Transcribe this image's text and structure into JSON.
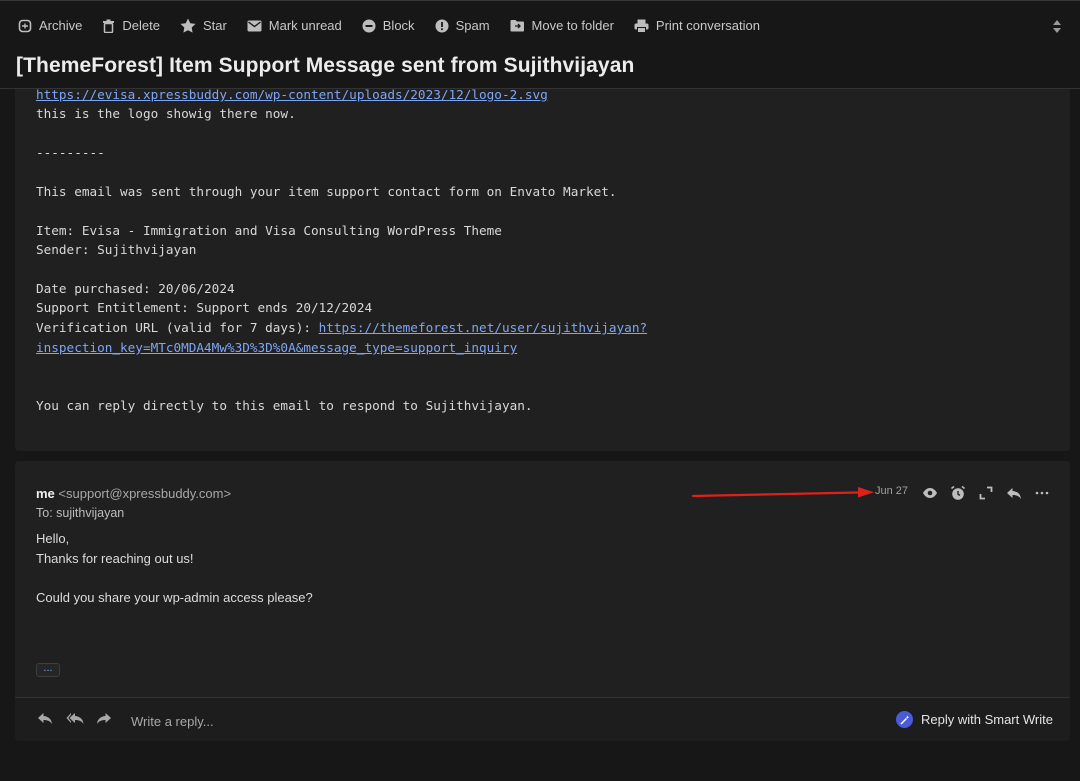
{
  "toolbar": {
    "buttons": [
      {
        "label": "Archive",
        "icon": "archive-icon"
      },
      {
        "label": "Delete",
        "icon": "trash-icon"
      },
      {
        "label": "Star",
        "icon": "star-icon"
      },
      {
        "label": "Mark unread",
        "icon": "mail-icon"
      },
      {
        "label": "Block",
        "icon": "block-icon"
      },
      {
        "label": "Spam",
        "icon": "spam-icon"
      },
      {
        "label": "Move to folder",
        "icon": "folder-icon"
      },
      {
        "label": "Print conversation",
        "icon": "printer-icon"
      }
    ]
  },
  "subject": "[ThemeForest] Item Support Message sent from Sujithvijayan",
  "message1": {
    "logo_link": "https://evisa.xpressbuddy.com/wp-content/uploads/2023/12/logo-2.svg",
    "line_logo": "this is the logo showig there now.",
    "separator": "---------",
    "line_sent": "This email was sent through your item support contact form on Envato Market.",
    "item": "Item: Evisa - Immigration and Visa Consulting WordPress Theme",
    "sender": "Sender: Sujithvijayan",
    "date_purchased": "Date purchased: 20/06/2024",
    "support": "Support Entitlement: Support ends 20/12/2024",
    "verification_label": "Verification URL (valid for 7 days): ",
    "verification_link_1": "https://themeforest.net/user/sujithvijayan?",
    "verification_link_2": "inspection_key=MTc0MDA4Mw%3D%3D%0A&message_type=support_inquiry",
    "reply_note": "You can reply directly to this email to respond to Sujithvijayan."
  },
  "message2": {
    "sender_name": "me",
    "sender_email": "<support@xpressbuddy.com>",
    "to": "To: sujithvijayan",
    "date": "Jun 27",
    "body": [
      "Hello,",
      "Thanks for reaching out us!",
      "Could you share your wp-admin access please?"
    ],
    "ellipsis": "...",
    "header_icons": [
      "eye-icon",
      "snooze-icon",
      "expand-icon",
      "reply-icon",
      "more-icon"
    ]
  },
  "reply_bar": {
    "placeholder": "Write a reply...",
    "smart_write_label": "Reply with Smart Write"
  },
  "annotation": {
    "arrow_color": "#e0201b"
  },
  "colors": {
    "background": "#171717",
    "card": "#202020",
    "link": "#7ea6f5",
    "accent": "#4a5bd6"
  }
}
